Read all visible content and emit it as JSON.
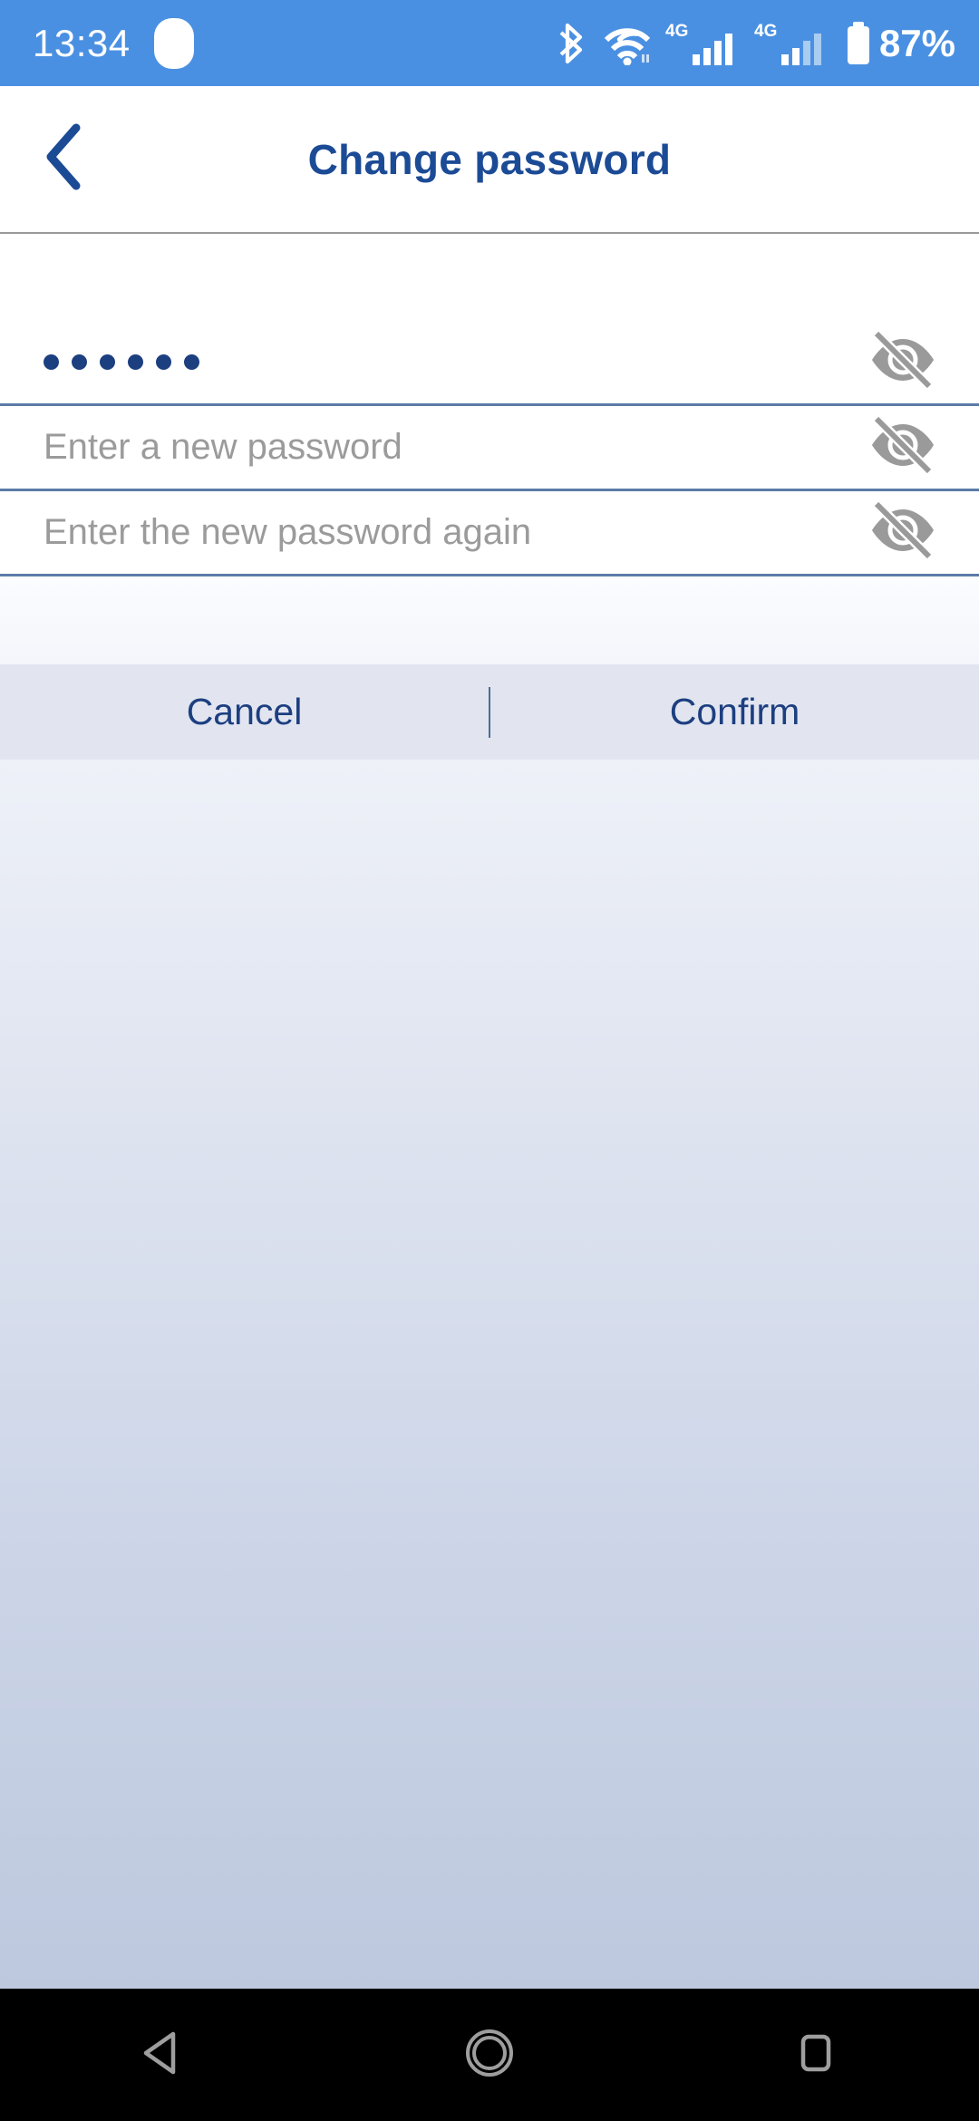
{
  "status_bar": {
    "time": "13:34",
    "battery_percent": "87%",
    "icons": [
      "notification-pill-icon",
      "bluetooth-icon",
      "wifi-icon",
      "signal-4g-1-icon",
      "signal-4g-2-icon",
      "battery-icon"
    ],
    "network_label_1": "4G",
    "network_label_2": "4G",
    "background_color": "#4a90e2",
    "foreground_color": "#ffffff"
  },
  "header": {
    "title": "Change password",
    "back_icon": "chevron-left-icon",
    "title_color": "#1c4b96"
  },
  "form": {
    "fields": [
      {
        "name": "current-password",
        "value": "••••••",
        "dot_count": 6,
        "placeholder": "",
        "toggle_icon": "eye-off-icon",
        "masked": true
      },
      {
        "name": "new-password",
        "value": "",
        "dot_count": 0,
        "placeholder": "Enter a new password",
        "toggle_icon": "eye-off-icon",
        "masked": true
      },
      {
        "name": "confirm-password",
        "value": "",
        "dot_count": 0,
        "placeholder": "Enter the new password again",
        "toggle_icon": "eye-off-icon",
        "masked": true
      }
    ],
    "underline_color": "#5b7ba8",
    "placeholder_color": "#9b9b9b",
    "dot_color": "#1c3f80"
  },
  "actions": {
    "cancel_label": "Cancel",
    "confirm_label": "Confirm",
    "background_color": "#e2e5f0",
    "text_color": "#1c3f80"
  },
  "nav_bar": {
    "back_icon": "triangle-back-icon",
    "home_icon": "circle-home-icon",
    "recents_icon": "square-recents-icon",
    "background_color": "#000000",
    "icon_color": "#9e9e9e"
  }
}
